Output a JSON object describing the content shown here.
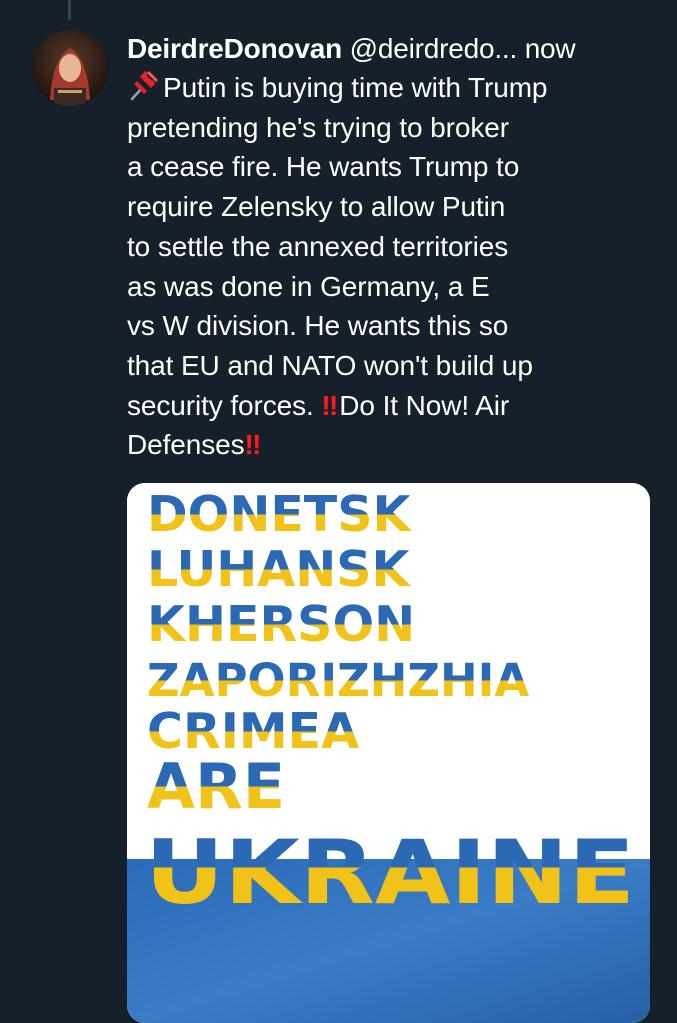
{
  "tweet": {
    "display_name": "DeirdreDonovan",
    "handle": "@deirdredo...",
    "timestamp": "now",
    "text_lines": [
      "Putin is buying time with Trump",
      "pretending he's trying to broker",
      "a cease fire. He wants Trump to",
      "require Zelensky to allow Putin",
      "to settle the annexed territories",
      "as was done in Germany, a E",
      "vs W division. He wants this so",
      "that EU and NATO won't build up",
      "security forces.",
      "Do It Now! Air",
      "Defenses"
    ],
    "emoji_pin": "pushpin-icon",
    "emoji_bang": "‼"
  },
  "media": {
    "words": [
      "DONETSK",
      "LUHANSK",
      "KHERSON",
      "ZAPORIZHZHIA",
      "CRIMEA",
      "ARE",
      "UKRAINE"
    ],
    "colors": {
      "blue": "#2c69b5",
      "yellow": "#f1c218",
      "background": "#ffffff"
    }
  },
  "colors": {
    "background": "#15202b",
    "text": "#ffffff",
    "accent_red": "#ff1a1a"
  }
}
